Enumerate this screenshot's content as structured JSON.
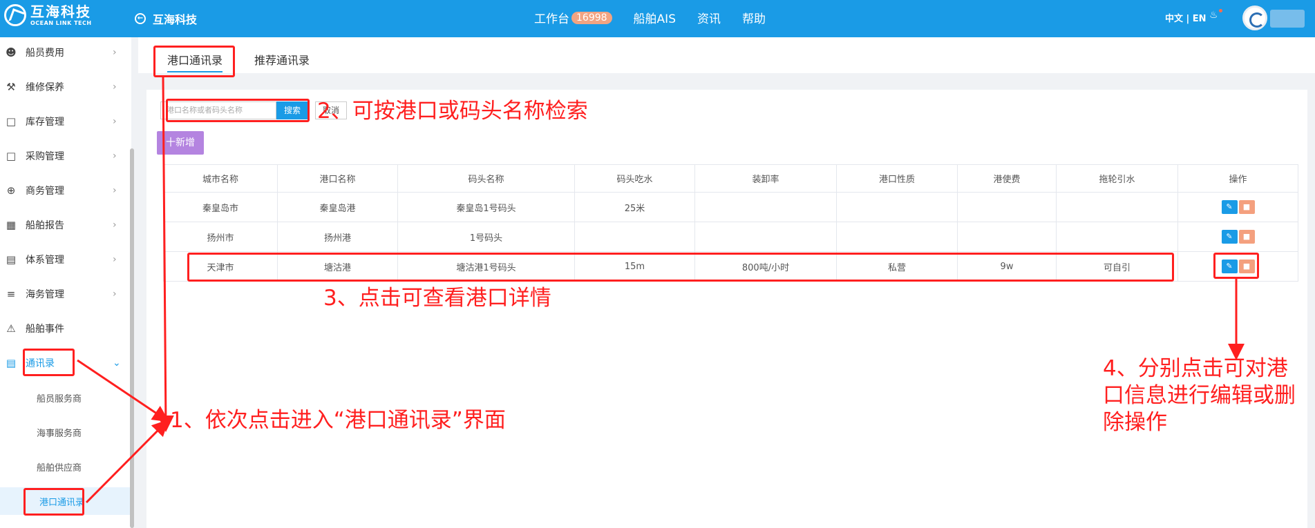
{
  "topbar": {
    "logo_cn": "互海科技",
    "logo_en": "OCEAN LINK TECH",
    "back_label": "互海科技",
    "nav": {
      "workbench": "工作台",
      "workbench_badge": "16998",
      "ais": "船舶AIS",
      "news": "资讯",
      "help": "帮助"
    },
    "lang": "中文 | EN"
  },
  "sidebar": {
    "items": [
      {
        "label": "船员费用",
        "icon": "person-icon"
      },
      {
        "label": "维修保养",
        "icon": "hammer-icon"
      },
      {
        "label": "库存管理",
        "icon": "bag-icon"
      },
      {
        "label": "采购管理",
        "icon": "cart-icon"
      },
      {
        "label": "商务管理",
        "icon": "globe-icon"
      },
      {
        "label": "船舶报告",
        "icon": "calendar-icon"
      },
      {
        "label": "体系管理",
        "icon": "document-icon"
      },
      {
        "label": "海务管理",
        "icon": "signpost-icon"
      },
      {
        "label": "船舶事件",
        "icon": "warning-icon"
      },
      {
        "label": "通讯录",
        "icon": "contacts-icon"
      }
    ],
    "sub_items": [
      "船员服务商",
      "海事服务商",
      "船舶供应商",
      "港口通讯录"
    ]
  },
  "tabs": [
    "港口通讯录",
    "推荐通讯录"
  ],
  "search": {
    "placeholder": "港口名称或者码头名称",
    "search_label": "搜索",
    "cancel_label": "取消"
  },
  "add_label": "十新增",
  "table": {
    "headers": [
      "城市名称",
      "港口名称",
      "码头名称",
      "码头吃水",
      "装卸率",
      "港口性质",
      "港使费",
      "拖轮引水",
      "操作"
    ],
    "rows": [
      [
        "秦皇岛市",
        "秦皇岛港",
        "秦皇岛1号码头",
        "25米",
        "",
        "",
        "",
        ""
      ],
      [
        "扬州市",
        "扬州港",
        "1号码头",
        "",
        "",
        "",
        "",
        ""
      ],
      [
        "天津市",
        "塘沽港",
        "塘沽港1号码头",
        "15m",
        "800吨/小时",
        "私营",
        "9w",
        "可自引"
      ]
    ]
  },
  "annotations": {
    "step1": "1、依次点击进入“港口通讯录”界面",
    "step2": "2、可按港口或码头名称检索",
    "step3": "3、点击可查看港口详情",
    "step4_line1": "4、分别点击可对港",
    "step4_line2": "口信息进行编辑或删",
    "step4_line3": "除操作"
  },
  "colors": {
    "topbar": "#1a9be6",
    "annotation": "#ff1f1f",
    "add_button": "#b484e0",
    "badge": "#f2a482"
  }
}
